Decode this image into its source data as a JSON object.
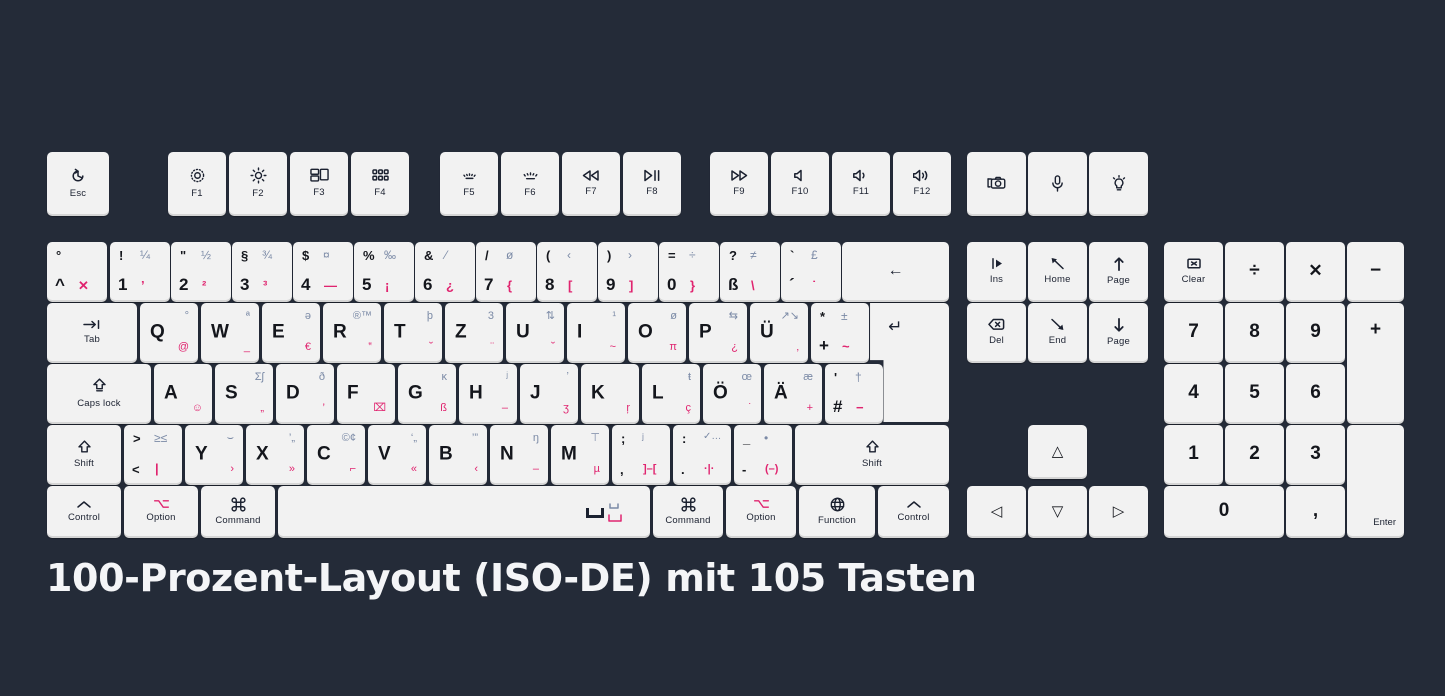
{
  "title": "100-Prozent-Layout (ISO-DE) mit 105 Tasten",
  "colors": {
    "background": "#242b38",
    "key_face": "#f2f2f2",
    "key_shadow": "#d5d5d5",
    "primary_legend": "#14161c",
    "alt_legend_blue": "#7b8aa6",
    "alt_legend_pink": "#e0246f",
    "title_text": "#f4f5f7"
  },
  "function_row": {
    "esc": {
      "label": "Esc",
      "icon": "power-undo-icon"
    },
    "keys": [
      {
        "label": "F1",
        "icon": "brightness-down-icon"
      },
      {
        "label": "F2",
        "icon": "brightness-up-icon"
      },
      {
        "label": "F3",
        "icon": "mission-control-icon"
      },
      {
        "label": "F4",
        "icon": "launchpad-grid-icon"
      },
      {
        "label": "F5",
        "icon": "keyboard-backlight-down-icon"
      },
      {
        "label": "F6",
        "icon": "keyboard-backlight-up-icon"
      },
      {
        "label": "F7",
        "icon": "rewind-icon"
      },
      {
        "label": "F8",
        "icon": "play-pause-icon"
      },
      {
        "label": "F9",
        "icon": "fast-forward-icon"
      },
      {
        "label": "F10",
        "icon": "mute-icon"
      },
      {
        "label": "F11",
        "icon": "volume-down-icon"
      },
      {
        "label": "F12",
        "icon": "volume-up-icon"
      }
    ],
    "extras": [
      {
        "icon": "screenshot-icon"
      },
      {
        "icon": "microphone-icon"
      },
      {
        "icon": "lightbulb-icon"
      }
    ]
  },
  "number_row": [
    {
      "tl": "°",
      "tr": "",
      "bl": "^",
      "br": "✕",
      "name": "key-caret"
    },
    {
      "tl": "!",
      "tr": "¼",
      "bl": "1",
      "br": "’",
      "name": "key-1"
    },
    {
      "tl": "\"",
      "tr": "½",
      "bl": "2",
      "br": "²",
      "name": "key-2"
    },
    {
      "tl": "§",
      "tr": "¾",
      "bl": "3",
      "br": "³",
      "name": "key-3"
    },
    {
      "tl": "$",
      "tr": "¤",
      "bl": "4",
      "br": "—",
      "name": "key-4"
    },
    {
      "tl": "%",
      "tr": "‰",
      "bl": "5",
      "br": "¡",
      "name": "key-5"
    },
    {
      "tl": "&",
      "tr": "⁄",
      "bl": "6",
      "br": "¿",
      "name": "key-6"
    },
    {
      "tl": "/",
      "tr": "ø",
      "bl": "7",
      "br": "{",
      "name": "key-7"
    },
    {
      "tl": "(",
      "tr": "‹",
      "bl": "8",
      "br": "[",
      "name": "key-8"
    },
    {
      "tl": ")",
      "tr": "›",
      "bl": "9",
      "br": "]",
      "name": "key-9"
    },
    {
      "tl": "=",
      "tr": "÷",
      "bl": "0",
      "br": "}",
      "name": "key-0"
    },
    {
      "tl": "?",
      "tr": "≠",
      "bl": "ß",
      "br": "\\",
      "name": "key-eszett"
    },
    {
      "tl": "`",
      "tr": "£",
      "bl": "´",
      "br": "˙",
      "name": "key-accent"
    }
  ],
  "backspace": {
    "icon": "backspace-arrow-icon",
    "glyph": "←"
  },
  "tab": {
    "label": "Tab",
    "icon": "tab-arrow-icon",
    "glyph": "⇥"
  },
  "qwertz_row": [
    {
      "main": "Q",
      "alt_top": "°",
      "alt_bot": "@",
      "name": "key-q"
    },
    {
      "main": "W",
      "alt_top": "ª",
      "alt_bot": "_",
      "name": "key-w"
    },
    {
      "main": "E",
      "alt_top": "ə",
      "alt_bot": "€",
      "name": "key-e"
    },
    {
      "main": "R",
      "alt_top": "®™",
      "alt_bot": "‟",
      "name": "key-r"
    },
    {
      "main": "T",
      "alt_top": "þ",
      "alt_bot": "˘",
      "name": "key-t"
    },
    {
      "main": "Z",
      "alt_top": "3",
      "alt_bot": "¨",
      "name": "key-z"
    },
    {
      "main": "U",
      "alt_top": "⇅",
      "alt_bot": "˘",
      "name": "key-u"
    },
    {
      "main": "I",
      "alt_top": "¹",
      "alt_bot": "~",
      "name": "key-i"
    },
    {
      "main": "O",
      "alt_top": "ø",
      "alt_bot": "π",
      "name": "key-o"
    },
    {
      "main": "P",
      "alt_top": "⇆",
      "alt_bot": "¿",
      "name": "key-p"
    },
    {
      "main": "Ü",
      "alt_top": "↗↘",
      "alt_bot": "‚",
      "name": "key-udiaeresis"
    },
    {
      "main": "*",
      "alt_top": "±",
      "alt_bot": "~",
      "name": "key-asterisk",
      "main2": "+"
    }
  ],
  "enter": {
    "glyph": "↵",
    "name": "enter-key"
  },
  "capslock": {
    "label": "Caps lock",
    "icon": "capslock-arrow-icon"
  },
  "home_row": [
    {
      "main": "A",
      "alt_top": "",
      "alt_bot": "☺",
      "name": "key-a"
    },
    {
      "main": "S",
      "alt_top": "Σʃ",
      "alt_bot": "„",
      "name": "key-s"
    },
    {
      "main": "D",
      "alt_top": "ð",
      "alt_bot": "’",
      "name": "key-d"
    },
    {
      "main": "F",
      "alt_top": "",
      "alt_bot": "⌧",
      "name": "key-f"
    },
    {
      "main": "G",
      "alt_top": "ĸ",
      "alt_bot": "ß",
      "name": "key-g"
    },
    {
      "main": "H",
      "alt_top": "ʲ",
      "alt_bot": "–",
      "name": "key-h"
    },
    {
      "main": "J",
      "alt_top": "ʼ",
      "alt_bot": "ʒ",
      "name": "key-j"
    },
    {
      "main": "K",
      "alt_top": "",
      "alt_bot": "ŗ",
      "name": "key-k"
    },
    {
      "main": "L",
      "alt_top": "ŧ",
      "alt_bot": "ç",
      "name": "key-l"
    },
    {
      "main": "Ö",
      "alt_top": "œ",
      "alt_bot": "˙",
      "name": "key-odiaeresis"
    },
    {
      "main": "Ä",
      "alt_top": "æ",
      "alt_bot": "+",
      "name": "key-adiaeresis"
    },
    {
      "main": "#",
      "alt_top": "†",
      "alt_bot": "−",
      "name": "key-hash",
      "main2": "'"
    }
  ],
  "shift_left": {
    "label": "Shift",
    "icon": "shift-arrow-icon"
  },
  "shift_right": {
    "label": "Shift",
    "icon": "shift-arrow-icon"
  },
  "bottom_letter_row": [
    {
      "tl": ">",
      "tr": "≥≤",
      "bl": "<",
      "br": "|",
      "name": "key-less-greater"
    },
    {
      "main": "Y",
      "alt_top": "⌣",
      "alt_bot": "›",
      "name": "key-y"
    },
    {
      "main": "X",
      "alt_top": "’„",
      "alt_bot": "»",
      "name": "key-x"
    },
    {
      "main": "C",
      "alt_top": "©¢",
      "alt_bot": "⌐",
      "name": "key-c"
    },
    {
      "main": "V",
      "alt_top": "‘„",
      "alt_bot": "«",
      "name": "key-v"
    },
    {
      "main": "B",
      "alt_top": "’”",
      "alt_bot": "‹",
      "name": "key-b"
    },
    {
      "main": "N",
      "alt_top": "ŋ",
      "alt_bot": "–",
      "name": "key-n"
    },
    {
      "main": "M",
      "alt_top": "⊤",
      "alt_bot": "µ",
      "name": "key-m"
    },
    {
      "tl": ";",
      "tr": "ʲ",
      "bl": ",",
      "br": "]–[",
      "name": "key-comma"
    },
    {
      "tl": ":",
      "tr": "✓…",
      "bl": ".",
      "br": "·|·",
      "name": "key-period"
    },
    {
      "tl": "_",
      "tr": "•",
      "bl": "-",
      "br": "(–)",
      "name": "key-minus"
    }
  ],
  "modifier_row": [
    {
      "label": "Control",
      "icon": "control-caret-icon",
      "name": "key-control-left"
    },
    {
      "label": "Option",
      "icon": "option-alt-icon",
      "name": "key-option-left"
    },
    {
      "label": "Command",
      "icon": "command-icon",
      "name": "key-command-left"
    },
    {
      "label": "",
      "icon": "spacebar-icon",
      "name": "key-space"
    },
    {
      "label": "Command",
      "icon": "command-icon",
      "name": "key-command-right"
    },
    {
      "label": "Option",
      "icon": "option-alt-icon",
      "name": "key-option-right"
    },
    {
      "label": "Function",
      "icon": "globe-icon",
      "name": "key-function"
    },
    {
      "label": "Control",
      "icon": "control-caret-icon",
      "name": "key-control-right"
    }
  ],
  "nav_cluster": [
    {
      "label": "Ins",
      "icon": "insert-icon",
      "name": "key-insert"
    },
    {
      "label": "Home",
      "icon": "home-arrow-icon",
      "name": "key-home"
    },
    {
      "label": "Page",
      "icon": "page-up-icon",
      "name": "key-page-up"
    },
    {
      "label": "Del",
      "icon": "delete-icon",
      "name": "key-delete"
    },
    {
      "label": "End",
      "icon": "end-arrow-icon",
      "name": "key-end"
    },
    {
      "label": "Page",
      "icon": "page-down-icon",
      "name": "key-page-down"
    }
  ],
  "arrows": [
    {
      "glyph": "△",
      "name": "key-arrow-up"
    },
    {
      "glyph": "◁",
      "name": "key-arrow-left"
    },
    {
      "glyph": "▽",
      "name": "key-arrow-down"
    },
    {
      "glyph": "▷",
      "name": "key-arrow-right"
    }
  ],
  "numpad": {
    "clear": {
      "label": "Clear",
      "icon": "clear-tag-icon"
    },
    "divide": "÷",
    "multiply": "✕",
    "minus": "−",
    "plus": "+",
    "n7": "7",
    "n8": "8",
    "n9": "9",
    "n4": "4",
    "n5": "5",
    "n6": "6",
    "n1": "1",
    "n2": "2",
    "n3": "3",
    "n0": "0",
    "comma": ",",
    "enter": "Enter"
  }
}
